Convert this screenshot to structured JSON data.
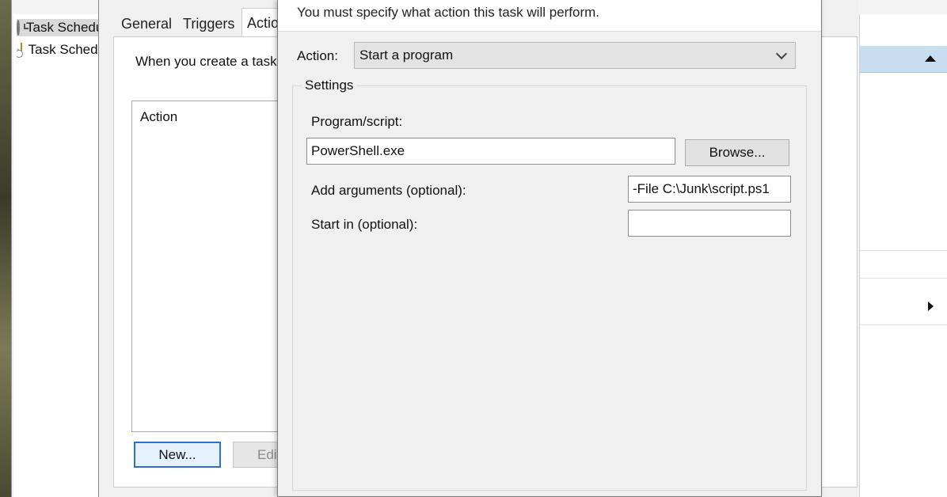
{
  "scheduler": {
    "tree": [
      {
        "label": "Task Scheduler (Local)",
        "selected": true,
        "icon": "clock-icon"
      },
      {
        "label": "Task Scheduler Library",
        "selected": false,
        "icon": "folder-icon"
      }
    ]
  },
  "task_dialog": {
    "tabs": [
      "General",
      "Triggers",
      "Actions"
    ],
    "active_tab": "Actions",
    "intro": "When you create a task, you must specify the action that will occur when your task starts.",
    "list_column": "Action",
    "new_button": "New...",
    "edit_button": "Edit..."
  },
  "action_dialog": {
    "instruction": "You must specify what action this task will perform.",
    "action_label": "Action:",
    "action_value": "Start a program",
    "settings_legend": "Settings",
    "program_label": "Program/script:",
    "program_value": "PowerShell.exe",
    "browse_button": "Browse...",
    "arguments_label": "Add arguments (optional):",
    "arguments_value": "-File C:\\Junk\\script.ps1",
    "start_in_label": "Start in (optional):",
    "start_in_value": ""
  }
}
